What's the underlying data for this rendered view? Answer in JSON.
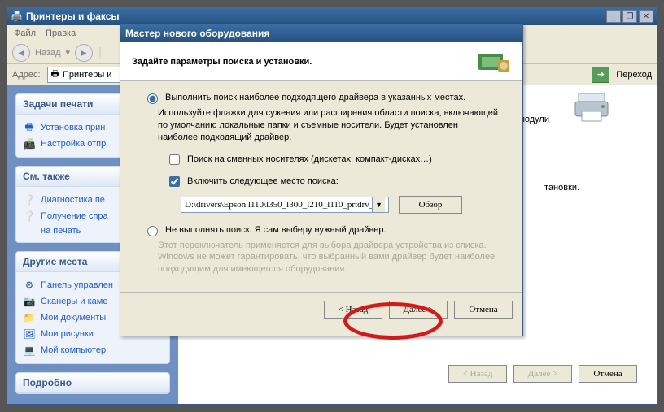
{
  "bg_window": {
    "title": "Принтеры и факсы",
    "menu": {
      "file": "Файл",
      "edit": "Правка"
    },
    "toolbar": {
      "back": "Назад"
    },
    "address": {
      "label": "Адрес:",
      "value": "Принтеры и",
      "go": "Переход"
    }
  },
  "sidebar": {
    "tasks": {
      "header": "Задачи печати",
      "items": [
        {
          "label": "Установка прин"
        },
        {
          "label": "Настройка отпр"
        }
      ]
    },
    "seealso": {
      "header": "См. также",
      "items": [
        {
          "label": "Диагностика пе"
        },
        {
          "label": "Получение спра"
        },
        {
          "label": "на печать"
        }
      ]
    },
    "other": {
      "header": "Другие места",
      "items": [
        {
          "label": "Панель управлен"
        },
        {
          "label": "Сканеры и каме"
        },
        {
          "label": "Мои документы"
        },
        {
          "label": "Мои рисунки"
        },
        {
          "label": "Мой компьютер"
        }
      ]
    },
    "details": {
      "header": "Подробно"
    }
  },
  "main": {
    "modules_label": "модули",
    "install_hint": "тановки."
  },
  "bg_buttons": {
    "back": "< Назад",
    "next": "Далее >",
    "cancel": "Отмена"
  },
  "dialog": {
    "title": "Мастер нового оборудования",
    "header": "Задайте параметры поиска и установки.",
    "opt_auto": "Выполнить поиск наиболее подходящего драйвера в указанных местах.",
    "auto_desc": "Используйте флажки для сужения или расширения области поиска, включающей по умолчанию локальные папки и съемные носители. Будет установлен наиболее подходящий драйвер.",
    "chk_removable": "Поиск на сменных носителях (дискетах, компакт-дисках…)",
    "chk_include": "Включить следующее место поиска:",
    "path": "D:\\drivers\\Epson l110\\l350_l300_l210_l110_prtdrv_",
    "browse": "Обзор",
    "opt_manual": "Не выполнять поиск. Я сам выберу нужный драйвер.",
    "manual_desc": "Этот переключатель применяется для выбора драйвера устройства из списка. Windows не может гарантировать, что выбранный вами драйвер будет наиболее подходящим для имеющегося оборудования.",
    "back": "< Назад",
    "next": "Далее >",
    "cancel": "Отмена"
  }
}
